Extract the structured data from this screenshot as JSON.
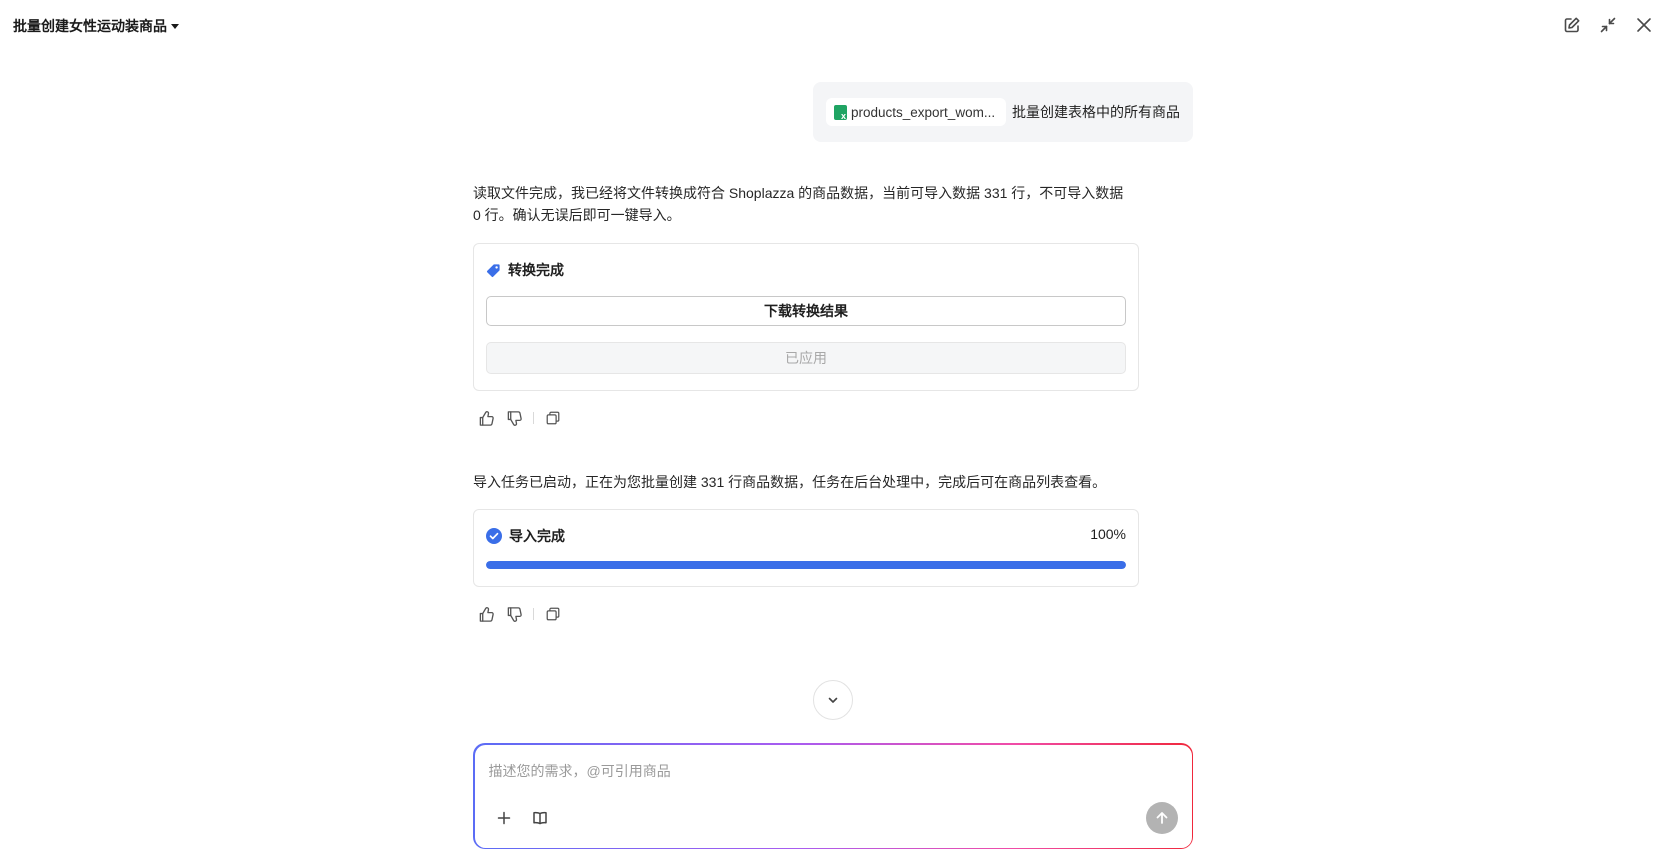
{
  "header": {
    "title": "批量创建女性运动装商品",
    "icons": [
      "edit-icon",
      "collapse-icon",
      "close-icon"
    ]
  },
  "user_message": {
    "attachment_name": "products_export_wom...",
    "text": "批量创建表格中的所有商品"
  },
  "reply1": {
    "text": "读取文件完成，我已经将文件转换成符合 Shoplazza 的商品数据，当前可导入数据 331 行，不可导入数据 0 行。确认无误后即可一键导入。",
    "card": {
      "title": "转换完成",
      "download_label": "下载转换结果",
      "applied_label": "已应用"
    }
  },
  "reply2": {
    "text": "导入任务已启动，正在为您批量创建 331 行商品数据，任务在后台处理中，完成后可在商品列表查看。",
    "card": {
      "title": "导入完成",
      "percent_label": "100%",
      "progress": 1.0
    }
  },
  "composer": {
    "placeholder": "描述您的需求，@可引用商品"
  },
  "colors": {
    "accent": "#3a6ee8",
    "gradient_start": "#5b6cf5",
    "gradient_end": "#f0283c"
  }
}
